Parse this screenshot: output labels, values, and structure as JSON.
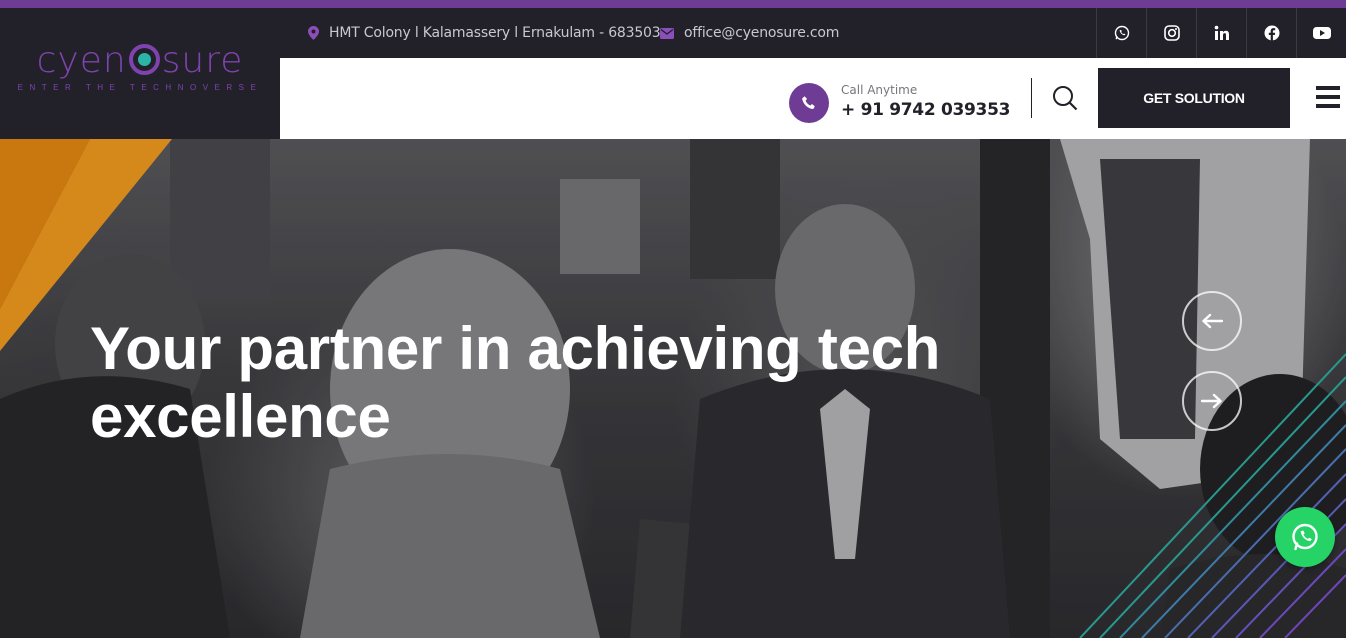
{
  "topbar": {
    "address": "HMT Colony l Kalamassery l Ernakulam - 683503",
    "email": "office@cyenosure.com",
    "social": [
      "whatsapp-icon",
      "instagram-icon",
      "linkedin-icon",
      "facebook-icon",
      "youtube-icon"
    ]
  },
  "logo": {
    "word_left": "cyen",
    "word_right": "sure",
    "tagline": "ENTER THE TECHNOVERSE"
  },
  "header": {
    "call_label": "Call Anytime",
    "call_number": "+ 91 9742 039353",
    "cta_label": "GET SOLUTION"
  },
  "hero": {
    "title": "Your partner in achieving tech excellence"
  },
  "colors": {
    "brand_purple": "#6e3c94",
    "dark": "#222129",
    "accent_orange": "#ffa21a",
    "accent_teal": "#2bb5a6",
    "whatsapp_green": "#25d366"
  }
}
